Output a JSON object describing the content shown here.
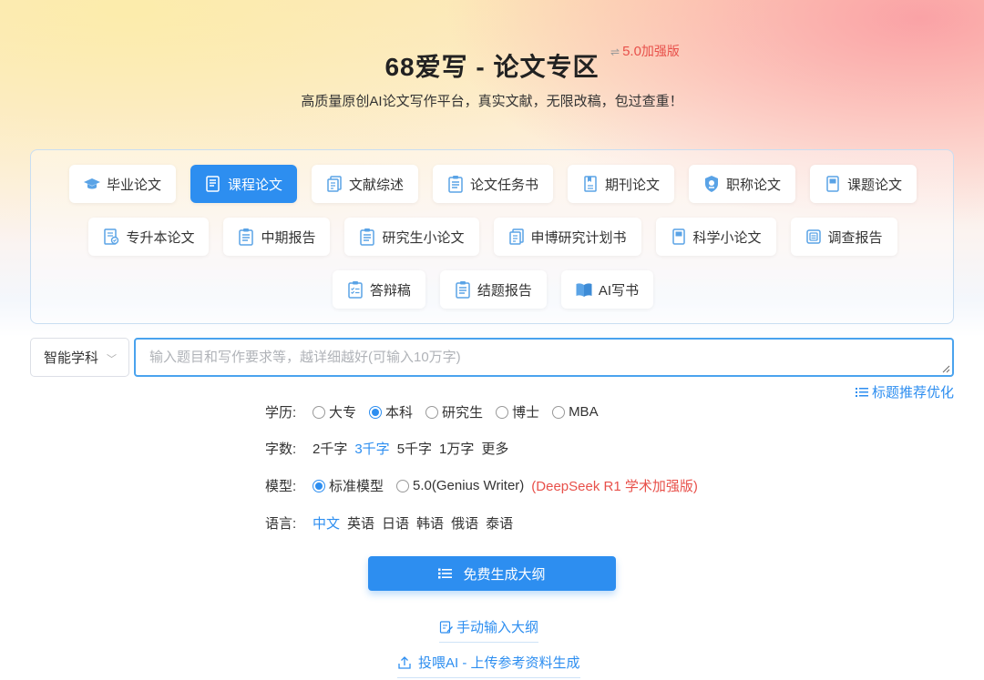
{
  "header": {
    "title": "68爱写 - 论文专区",
    "version_switch_icon": "⇌",
    "version_num": "5.0",
    "version_text": "加强版",
    "subtitle": "高质量原创AI论文写作平台，真实文献，无限改稿，包过查重！"
  },
  "paper_types": [
    {
      "label": "毕业论文",
      "icon": "graduation-cap-icon",
      "active": false
    },
    {
      "label": "课程论文",
      "icon": "document-icon",
      "active": true
    },
    {
      "label": "文献综述",
      "icon": "documents-icon",
      "active": false
    },
    {
      "label": "论文任务书",
      "icon": "clipboard-icon",
      "active": false
    },
    {
      "label": "期刊论文",
      "icon": "journal-icon",
      "active": false
    },
    {
      "label": "职称论文",
      "icon": "shield-icon",
      "active": false
    },
    {
      "label": "课题论文",
      "icon": "notebook-icon",
      "active": false
    },
    {
      "label": "专升本论文",
      "icon": "doc-edit-icon",
      "active": false
    },
    {
      "label": "中期报告",
      "icon": "clipboard-icon",
      "active": false
    },
    {
      "label": "研究生小论文",
      "icon": "clipboard-icon",
      "active": false
    },
    {
      "label": "申博研究计划书",
      "icon": "documents-icon",
      "active": false
    },
    {
      "label": "科学小论文",
      "icon": "notebook-icon",
      "active": false
    },
    {
      "label": "调查报告",
      "icon": "report-icon",
      "active": false
    },
    {
      "label": "答辩稿",
      "icon": "checklist-icon",
      "active": false
    },
    {
      "label": "结题报告",
      "icon": "clipboard-icon",
      "active": false
    },
    {
      "label": "AI写书",
      "icon": "open-book-icon",
      "active": false
    }
  ],
  "subject": {
    "value": "智能学科",
    "chevron": "﹀"
  },
  "topic": {
    "placeholder": "输入题目和写作要求等，越详细越好(可输入10万字)",
    "value": ""
  },
  "title_optimize": "标题推荐优化",
  "education": {
    "label": "学历:",
    "options": [
      "大专",
      "本科",
      "研究生",
      "博士",
      "MBA"
    ],
    "selected": "本科"
  },
  "word_count": {
    "label": "字数:",
    "options": [
      "2千字",
      "3千字",
      "5千字",
      "1万字",
      "更多"
    ],
    "selected": "3千字"
  },
  "model": {
    "label": "模型:",
    "options": [
      "标准模型",
      "5.0(Genius Writer)"
    ],
    "selected": "标准模型",
    "note": "(DeepSeek R1 学术加强版)"
  },
  "language": {
    "label": "语言:",
    "options": [
      "中文",
      "英语",
      "日语",
      "韩语",
      "俄语",
      "泰语"
    ],
    "selected": "中文"
  },
  "actions": {
    "generate": "免费生成大纲",
    "manual": "手动输入大纲",
    "upload": "投喂AI - 上传参考资料生成"
  },
  "colors": {
    "accent": "#2d8ef0",
    "warning": "#e8504a"
  }
}
